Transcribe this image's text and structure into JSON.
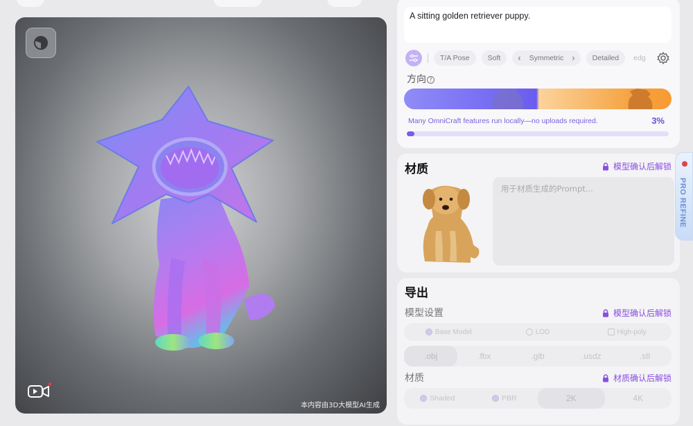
{
  "prompt": {
    "text": "A sitting golden retriever puppy.",
    "chips": [
      "T/A Pose",
      "Soft",
      "Symmetric",
      "Detailed",
      "edg"
    ]
  },
  "direction": {
    "label": "方向",
    "help": "?"
  },
  "progress": {
    "message": "Many OmniCraft features run locally—no uploads required.",
    "percent_label": "3%",
    "percent": 3
  },
  "material": {
    "title": "材质",
    "lock_label": "模型确认后解锁",
    "prompt_placeholder": "用于材质生成的Prompt..."
  },
  "pro_refine": {
    "label": "PRO REFINE"
  },
  "export": {
    "title": "导出",
    "model_settings": {
      "label": "模型设置",
      "lock_label": "模型确认后解锁",
      "options": [
        "Base Model",
        "LOD",
        "High-poly"
      ]
    },
    "formats": [
      ".obj",
      ".fbx",
      ".glb",
      ".usdz",
      ".stl"
    ],
    "material": {
      "label": "材质",
      "lock_label": "材质确认后解锁",
      "options": [
        "Shaded",
        "PBR",
        "2K",
        "4K"
      ]
    }
  },
  "viewport": {
    "watermark": "本内容由3D大模型AI生成"
  },
  "colors": {
    "accent": "#7b5ce6",
    "lock": "#8a4fe0",
    "gradient_left": "#6a5cf0",
    "gradient_right": "#f5a342"
  }
}
